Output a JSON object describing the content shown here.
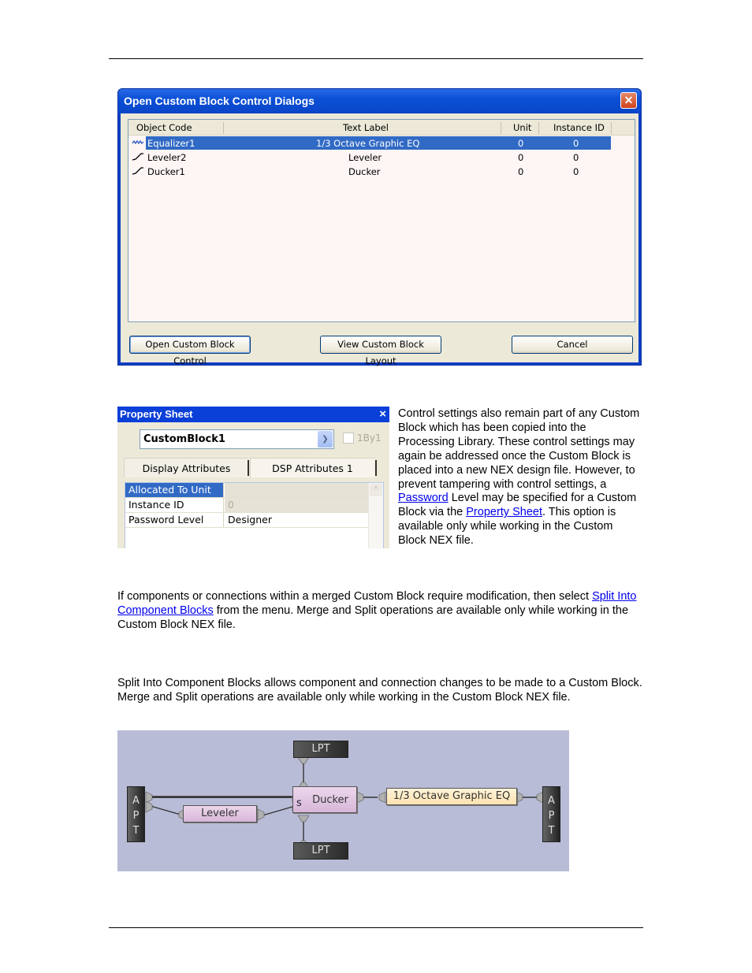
{
  "dialog": {
    "title": "Open Custom Block Control Dialogs",
    "close_icon": "close-icon",
    "columns": [
      "Object Code",
      "Text Label",
      "Unit",
      "Instance ID"
    ],
    "rows": [
      {
        "icon": "equalizer-wave-icon",
        "object_code": "Equalizer1",
        "text_label": "1/3 Octave Graphic EQ",
        "unit": "0",
        "instance_id": "0",
        "selected": true
      },
      {
        "icon": "leveler-curve-icon",
        "object_code": "Leveler2",
        "text_label": "Leveler",
        "unit": "0",
        "instance_id": "0",
        "selected": false
      },
      {
        "icon": "ducker-curve-icon",
        "object_code": "Ducker1",
        "text_label": "Ducker",
        "unit": "0",
        "instance_id": "0",
        "selected": false
      }
    ],
    "buttons": {
      "open": "Open Custom Block Control",
      "view": "View Custom Block Layout",
      "cancel": "Cancel"
    }
  },
  "property_sheet": {
    "title": "Property Sheet",
    "close_icon": "×",
    "selected_object": "CustomBlock1",
    "checkbox_label": "1By1",
    "tabs": [
      "Display Attributes",
      "DSP Attributes 1"
    ],
    "rows": [
      {
        "key": "Allocated To Unit",
        "value": ""
      },
      {
        "key": "Instance ID",
        "value": "0"
      },
      {
        "key": "Password Level",
        "value": "Designer"
      }
    ]
  },
  "side_text": {
    "part1": "Control settings also remain part of any Custom Block which has been copied into the Processing Library. These control settings may again be addressed once the Custom Block is placed into a new NEX design file. However, to prevent tampering with control settings, a ",
    "link1": "Password",
    "part2": " Level may be specified for a Custom Block via the ",
    "link2": "Property Sheet",
    "part3": ". This option is available only while working in the Custom Block NEX file."
  },
  "para1": {
    "part1": "If components or connections within a merged Custom Block require modification, then select ",
    "link": "Split Into Component Blocks",
    "part2": " from the menu. Merge and Split operations are available only while working in the Custom Block NEX file."
  },
  "para2": {
    "text": "Split Into Component Blocks allows component and connection changes to be made to a Custom Block. Merge and Split operations are available only while working in the Custom Block NEX file."
  },
  "diagram": {
    "lpt_top": "LPT",
    "lpt_bottom": "LPT",
    "apt_left": [
      "A",
      "P",
      "T"
    ],
    "apt_right": [
      "A",
      "P",
      "T"
    ],
    "leveler": "Leveler",
    "ducker": "Ducker",
    "ducker_sidechain": "s",
    "eq": "1/3 Octave Graphic EQ"
  }
}
